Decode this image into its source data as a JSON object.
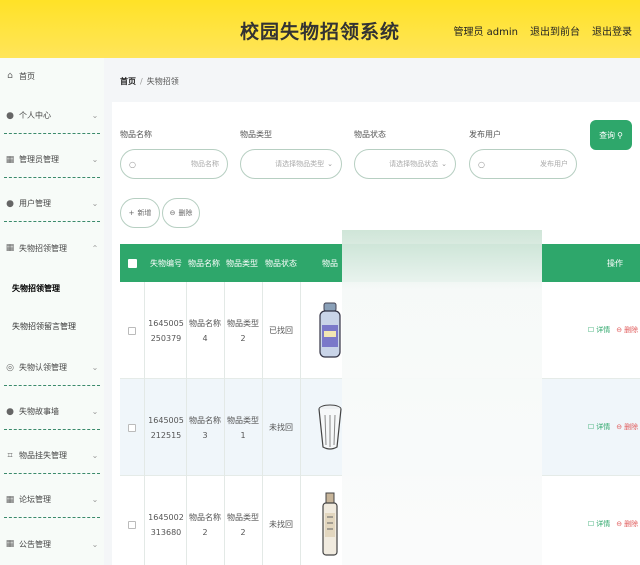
{
  "header": {
    "title": "校园失物招领系统",
    "user_label": "管理员 admin",
    "front_link": "退出到前台",
    "logout_link": "退出登录"
  },
  "sidebar": {
    "items": [
      {
        "label": "首页",
        "icon": "home-icon"
      },
      {
        "label": "个人中心",
        "icon": "user-icon"
      },
      {
        "label": "管理员管理",
        "icon": "grid-icon"
      },
      {
        "label": "用户管理",
        "icon": "user-icon"
      },
      {
        "label": "失物招领管理",
        "icon": "grid-icon"
      },
      {
        "label": "失物认领管理",
        "icon": "globe-icon"
      },
      {
        "label": "失物故事墙",
        "icon": "user-icon"
      },
      {
        "label": "物品挂失管理",
        "icon": "frame-icon"
      },
      {
        "label": "论坛管理",
        "icon": "grid-icon"
      },
      {
        "label": "公告管理",
        "icon": "grid-icon"
      }
    ],
    "sub_items": [
      "失物招领管理",
      "失物招领留言管理"
    ]
  },
  "breadcrumb": {
    "home": "首页",
    "current": "失物招领"
  },
  "filters": [
    {
      "label": "物品名称",
      "placeholder": "物品名称"
    },
    {
      "label": "物品类型",
      "placeholder": "请选择物品类型"
    },
    {
      "label": "物品状态",
      "placeholder": "请选择物品状态"
    },
    {
      "label": "发布用户",
      "placeholder": "发布用户"
    }
  ],
  "buttons": {
    "search": "查询",
    "add": "新增",
    "delete": "删除"
  },
  "table": {
    "headers": [
      "失物编号",
      "物品名称",
      "物品类型",
      "物品状态",
      "物品",
      "操作"
    ],
    "rows": [
      {
        "id1": "1645005",
        "id2": "250379",
        "name1": "物品名称",
        "name2": "4",
        "type1": "物品类型",
        "type2": "2",
        "status": "已找回"
      },
      {
        "id1": "1645005",
        "id2": "212515",
        "name1": "物品名称",
        "name2": "3",
        "type1": "物品类型",
        "type2": "1",
        "status": "未找回"
      },
      {
        "id1": "1645002",
        "id2": "313680",
        "name1": "物品名称",
        "name2": "2",
        "type1": "物品类型",
        "type2": "2",
        "status": "未找回"
      }
    ],
    "ops": {
      "detail": "详情",
      "delete": "删除"
    }
  },
  "colors": {
    "header": "#ffe227",
    "accent": "#2ea76b",
    "danger": "#e05a5a"
  }
}
